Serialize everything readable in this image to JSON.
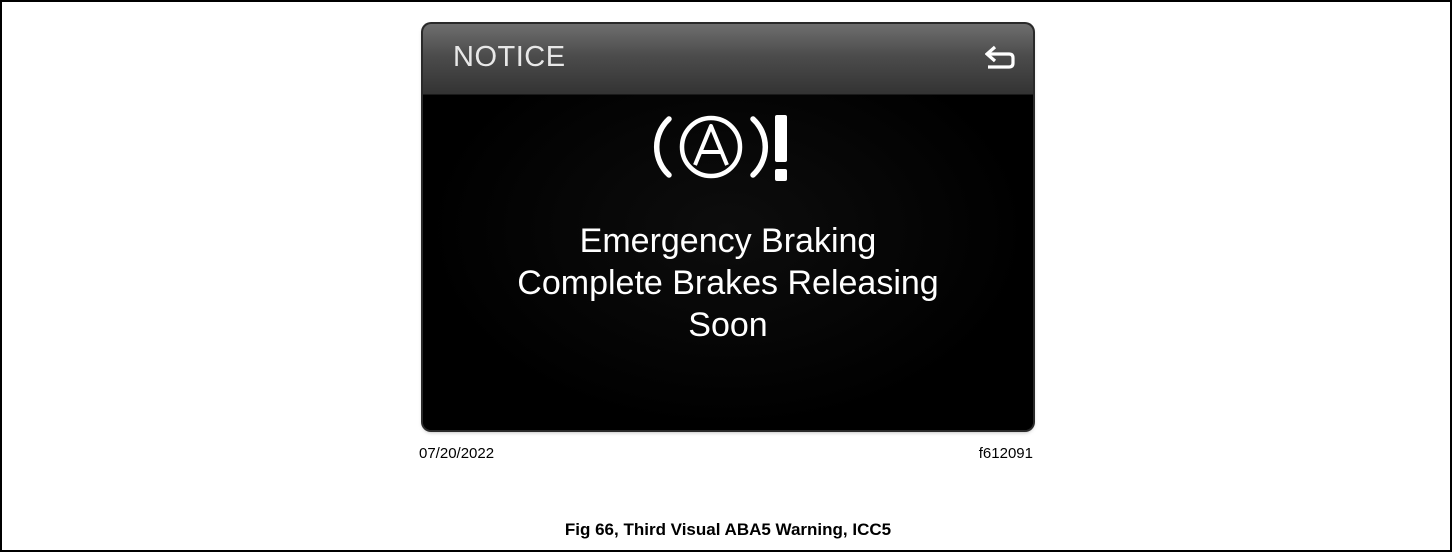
{
  "screen": {
    "header_title": "NOTICE",
    "back_icon": "return-arrow-icon",
    "warning_icon": "active-brake-assist-warning-icon",
    "message_lines": [
      "Emergency Braking",
      "Complete Brakes Releasing",
      "Soon"
    ]
  },
  "figure": {
    "date": "07/20/2022",
    "image_id": "f612091",
    "caption": "Fig 66, Third Visual ABA5 Warning, ICC5"
  },
  "colors": {
    "screen_background": "#000000",
    "header_gradient_top": "#6e6e6e",
    "header_gradient_bottom": "#333333",
    "text_primary": "#ffffff",
    "header_text": "#e8e8e8"
  }
}
